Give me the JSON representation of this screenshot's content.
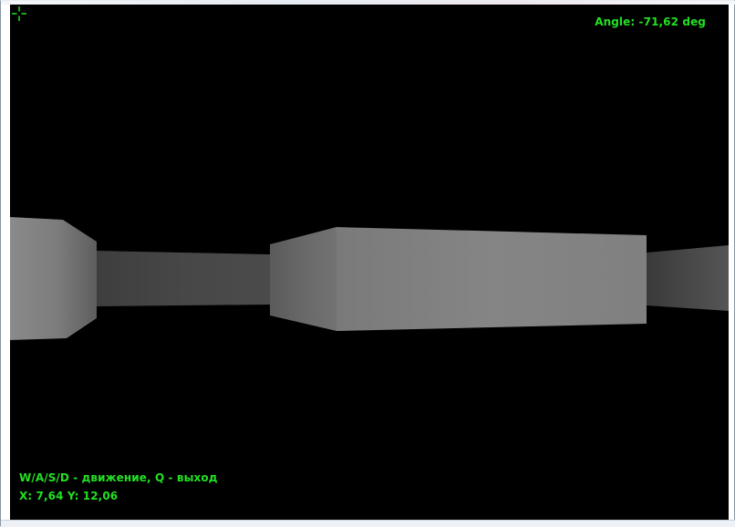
{
  "hud": {
    "angle_label": "Angle:",
    "angle_value": "-71,62",
    "angle_unit": "deg",
    "controls_hint": "W/A/S/D - движение, Q - выход",
    "x_label": "X:",
    "x_value": "7,64",
    "y_label": "Y:",
    "y_value": "12,06"
  },
  "colors": {
    "hud_text": "#22e022",
    "background": "#000000",
    "wall_light": "#808080",
    "wall_dark": "#555555",
    "window_frame": "#ffffff"
  },
  "icons": {
    "crosshair": "crosshair-icon"
  }
}
